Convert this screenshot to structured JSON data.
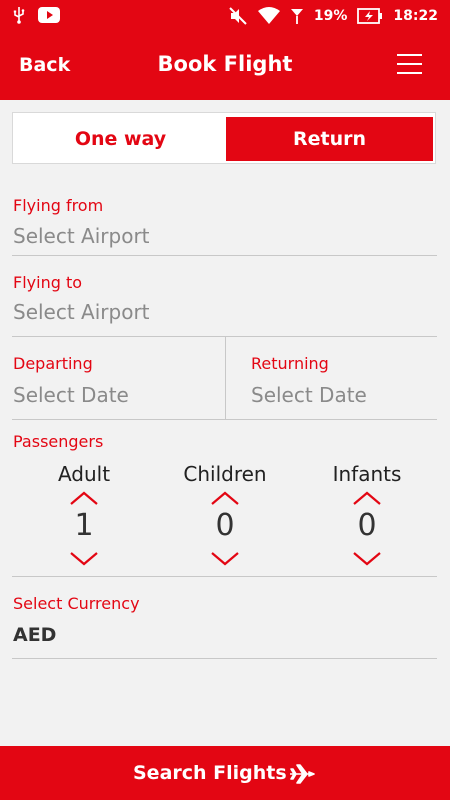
{
  "status_bar": {
    "battery": "19%",
    "time": "18:22",
    "icons": [
      "usb-icon",
      "youtube-icon",
      "mute-icon",
      "wifi-icon",
      "signal-icon",
      "battery-charging-icon"
    ]
  },
  "header": {
    "back_label": "Back",
    "title": "Book Flight",
    "menu_icon": "hamburger-menu-icon"
  },
  "trip_type": {
    "options": [
      "One way",
      "Return"
    ],
    "selected": "Return"
  },
  "form": {
    "from": {
      "label": "Flying from",
      "placeholder": "Select Airport"
    },
    "to": {
      "label": "Flying to",
      "placeholder": "Select Airport"
    },
    "departing": {
      "label": "Departing",
      "placeholder": "Select Date"
    },
    "returning": {
      "label": "Returning",
      "placeholder": "Select Date"
    }
  },
  "passengers": {
    "label": "Passengers",
    "items": [
      {
        "label": "Adult",
        "value": "1"
      },
      {
        "label": "Children",
        "value": "0"
      },
      {
        "label": "Infants",
        "value": "0"
      }
    ]
  },
  "currency": {
    "label": "Select Currency",
    "value": "AED"
  },
  "search": {
    "label": "Search Flights",
    "icon": "airplane-icon"
  },
  "colors": {
    "accent": "#e30613",
    "placeholder": "#8a8a8a",
    "background": "#f2f2f2"
  }
}
